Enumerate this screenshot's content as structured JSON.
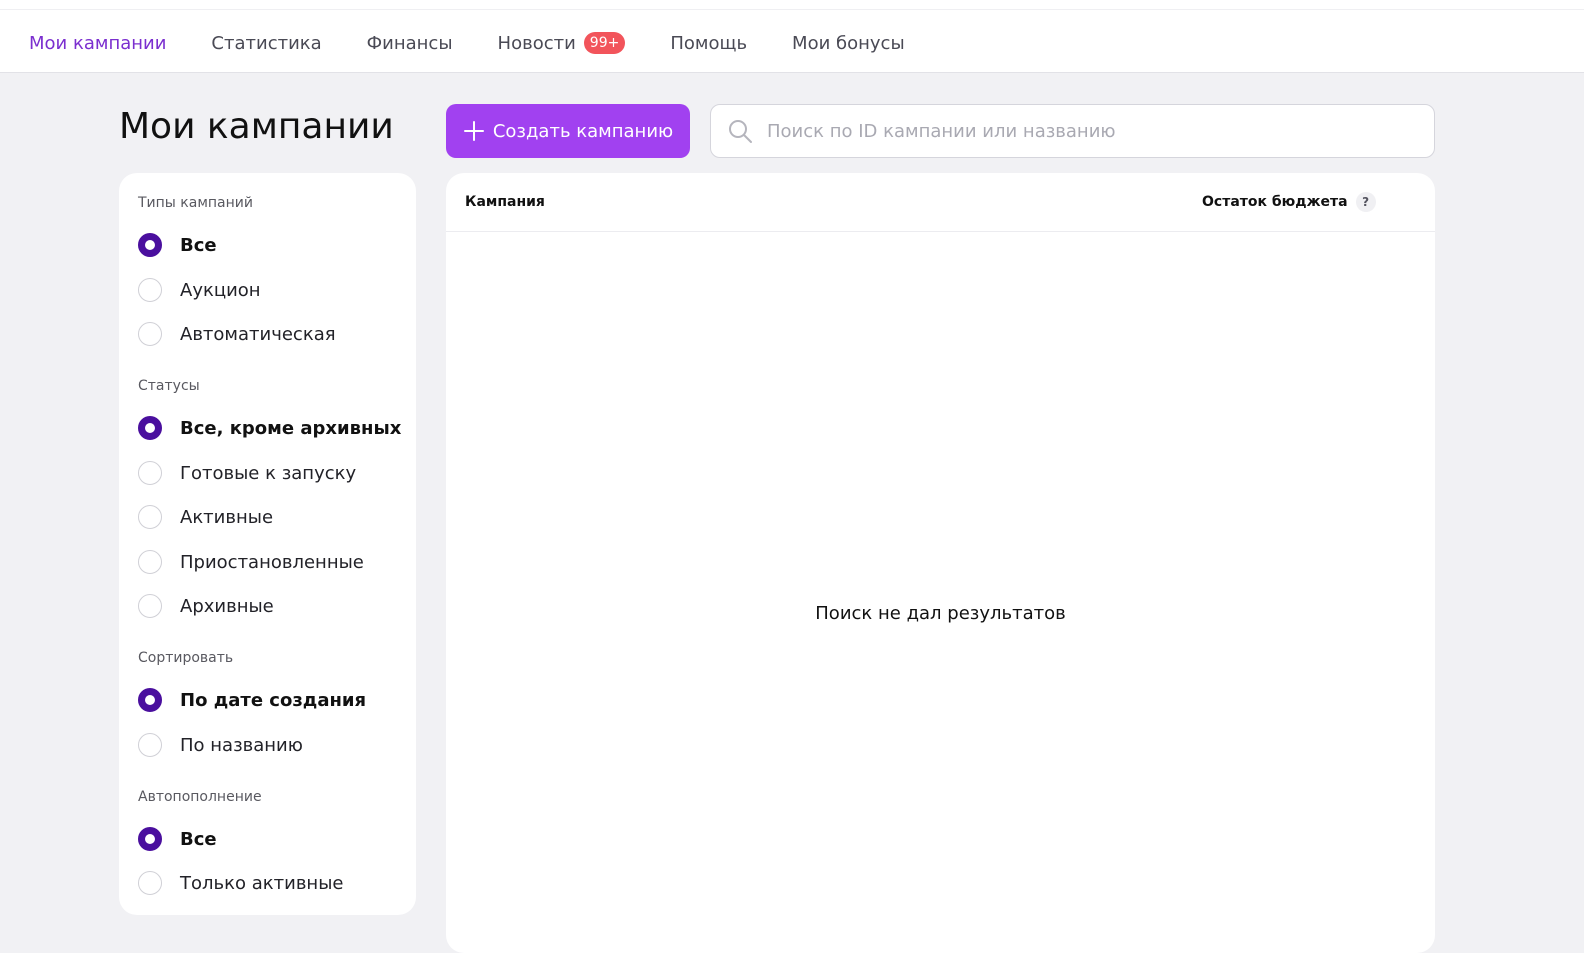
{
  "nav": {
    "items": [
      {
        "label": "Мои кампании",
        "active": true
      },
      {
        "label": "Статистика",
        "active": false
      },
      {
        "label": "Финансы",
        "active": false
      },
      {
        "label": "Новости",
        "active": false,
        "badge": "99+"
      },
      {
        "label": "Помощь",
        "active": false
      },
      {
        "label": "Мои бонусы",
        "active": false
      }
    ]
  },
  "page": {
    "title": "Мои кампании"
  },
  "toolbar": {
    "create_label": "Создать кампанию",
    "search_placeholder": "Поиск по ID кампании или названию",
    "search_value": ""
  },
  "filters": {
    "types": {
      "title": "Типы кампаний",
      "options": [
        "Все",
        "Аукцион",
        "Автоматическая"
      ],
      "selected": 0
    },
    "statuses": {
      "title": "Статусы",
      "options": [
        "Все, кроме архивных",
        "Готовые к запуску",
        "Активные",
        "Приостановленные",
        "Архивные"
      ],
      "selected": 0
    },
    "sort": {
      "title": "Сортировать",
      "options": [
        "По дате создания",
        "По названию"
      ],
      "selected": 0
    },
    "autorefill": {
      "title": "Автопополнение",
      "options": [
        "Все",
        "Только активные"
      ],
      "selected": 0
    }
  },
  "table": {
    "col_campaign": "Кампания",
    "col_budget": "Остаток бюджета",
    "help_glyph": "?",
    "empty_message": "Поиск не дал результатов"
  },
  "colors": {
    "accent": "#a141f0",
    "active_nav": "#7b2fcf",
    "radio_checked": "#4a0f9e",
    "badge": "#f2545b"
  }
}
